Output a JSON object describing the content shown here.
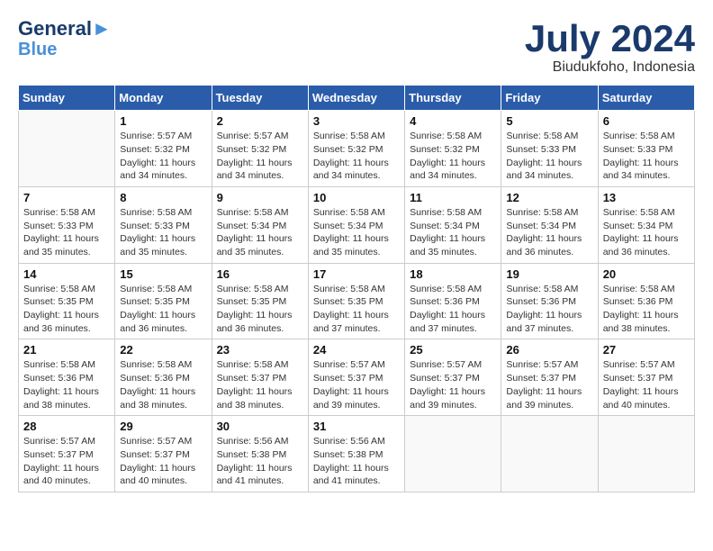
{
  "header": {
    "logo_line1": "General",
    "logo_line2": "Blue",
    "month": "July 2024",
    "location": "Biudukfoho, Indonesia"
  },
  "weekdays": [
    "Sunday",
    "Monday",
    "Tuesday",
    "Wednesday",
    "Thursday",
    "Friday",
    "Saturday"
  ],
  "weeks": [
    [
      {
        "day": "",
        "info": ""
      },
      {
        "day": "1",
        "info": "Sunrise: 5:57 AM\nSunset: 5:32 PM\nDaylight: 11 hours\nand 34 minutes."
      },
      {
        "day": "2",
        "info": "Sunrise: 5:57 AM\nSunset: 5:32 PM\nDaylight: 11 hours\nand 34 minutes."
      },
      {
        "day": "3",
        "info": "Sunrise: 5:58 AM\nSunset: 5:32 PM\nDaylight: 11 hours\nand 34 minutes."
      },
      {
        "day": "4",
        "info": "Sunrise: 5:58 AM\nSunset: 5:32 PM\nDaylight: 11 hours\nand 34 minutes."
      },
      {
        "day": "5",
        "info": "Sunrise: 5:58 AM\nSunset: 5:33 PM\nDaylight: 11 hours\nand 34 minutes."
      },
      {
        "day": "6",
        "info": "Sunrise: 5:58 AM\nSunset: 5:33 PM\nDaylight: 11 hours\nand 34 minutes."
      }
    ],
    [
      {
        "day": "7",
        "info": "Sunrise: 5:58 AM\nSunset: 5:33 PM\nDaylight: 11 hours\nand 35 minutes."
      },
      {
        "day": "8",
        "info": "Sunrise: 5:58 AM\nSunset: 5:33 PM\nDaylight: 11 hours\nand 35 minutes."
      },
      {
        "day": "9",
        "info": "Sunrise: 5:58 AM\nSunset: 5:34 PM\nDaylight: 11 hours\nand 35 minutes."
      },
      {
        "day": "10",
        "info": "Sunrise: 5:58 AM\nSunset: 5:34 PM\nDaylight: 11 hours\nand 35 minutes."
      },
      {
        "day": "11",
        "info": "Sunrise: 5:58 AM\nSunset: 5:34 PM\nDaylight: 11 hours\nand 35 minutes."
      },
      {
        "day": "12",
        "info": "Sunrise: 5:58 AM\nSunset: 5:34 PM\nDaylight: 11 hours\nand 36 minutes."
      },
      {
        "day": "13",
        "info": "Sunrise: 5:58 AM\nSunset: 5:34 PM\nDaylight: 11 hours\nand 36 minutes."
      }
    ],
    [
      {
        "day": "14",
        "info": "Sunrise: 5:58 AM\nSunset: 5:35 PM\nDaylight: 11 hours\nand 36 minutes."
      },
      {
        "day": "15",
        "info": "Sunrise: 5:58 AM\nSunset: 5:35 PM\nDaylight: 11 hours\nand 36 minutes."
      },
      {
        "day": "16",
        "info": "Sunrise: 5:58 AM\nSunset: 5:35 PM\nDaylight: 11 hours\nand 36 minutes."
      },
      {
        "day": "17",
        "info": "Sunrise: 5:58 AM\nSunset: 5:35 PM\nDaylight: 11 hours\nand 37 minutes."
      },
      {
        "day": "18",
        "info": "Sunrise: 5:58 AM\nSunset: 5:36 PM\nDaylight: 11 hours\nand 37 minutes."
      },
      {
        "day": "19",
        "info": "Sunrise: 5:58 AM\nSunset: 5:36 PM\nDaylight: 11 hours\nand 37 minutes."
      },
      {
        "day": "20",
        "info": "Sunrise: 5:58 AM\nSunset: 5:36 PM\nDaylight: 11 hours\nand 38 minutes."
      }
    ],
    [
      {
        "day": "21",
        "info": "Sunrise: 5:58 AM\nSunset: 5:36 PM\nDaylight: 11 hours\nand 38 minutes."
      },
      {
        "day": "22",
        "info": "Sunrise: 5:58 AM\nSunset: 5:36 PM\nDaylight: 11 hours\nand 38 minutes."
      },
      {
        "day": "23",
        "info": "Sunrise: 5:58 AM\nSunset: 5:37 PM\nDaylight: 11 hours\nand 38 minutes."
      },
      {
        "day": "24",
        "info": "Sunrise: 5:57 AM\nSunset: 5:37 PM\nDaylight: 11 hours\nand 39 minutes."
      },
      {
        "day": "25",
        "info": "Sunrise: 5:57 AM\nSunset: 5:37 PM\nDaylight: 11 hours\nand 39 minutes."
      },
      {
        "day": "26",
        "info": "Sunrise: 5:57 AM\nSunset: 5:37 PM\nDaylight: 11 hours\nand 39 minutes."
      },
      {
        "day": "27",
        "info": "Sunrise: 5:57 AM\nSunset: 5:37 PM\nDaylight: 11 hours\nand 40 minutes."
      }
    ],
    [
      {
        "day": "28",
        "info": "Sunrise: 5:57 AM\nSunset: 5:37 PM\nDaylight: 11 hours\nand 40 minutes."
      },
      {
        "day": "29",
        "info": "Sunrise: 5:57 AM\nSunset: 5:37 PM\nDaylight: 11 hours\nand 40 minutes."
      },
      {
        "day": "30",
        "info": "Sunrise: 5:56 AM\nSunset: 5:38 PM\nDaylight: 11 hours\nand 41 minutes."
      },
      {
        "day": "31",
        "info": "Sunrise: 5:56 AM\nSunset: 5:38 PM\nDaylight: 11 hours\nand 41 minutes."
      },
      {
        "day": "",
        "info": ""
      },
      {
        "day": "",
        "info": ""
      },
      {
        "day": "",
        "info": ""
      }
    ]
  ]
}
